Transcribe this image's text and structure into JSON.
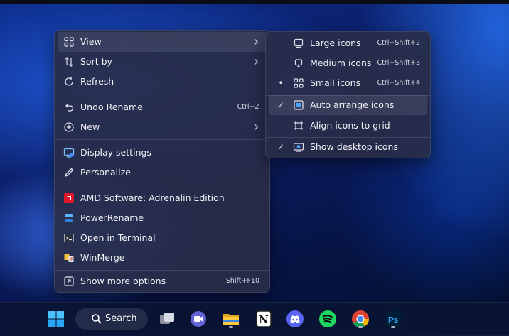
{
  "context_menu": {
    "items": [
      {
        "label": "View",
        "icon": "grid-view-icon",
        "submenu": true
      },
      {
        "label": "Sort by",
        "icon": "sort-icon",
        "submenu": true
      },
      {
        "label": "Refresh",
        "icon": "refresh-icon"
      },
      {
        "label": "Undo Rename",
        "icon": "undo-icon",
        "shortcut": "Ctrl+Z"
      },
      {
        "label": "New",
        "icon": "add-circle-icon",
        "submenu": true
      },
      {
        "label": "Display settings",
        "icon": "display-icon"
      },
      {
        "label": "Personalize",
        "icon": "pen-icon"
      },
      {
        "label": "AMD Software: Adrenalin Edition",
        "icon": "amd-icon"
      },
      {
        "label": "PowerRename",
        "icon": "powerrename-icon"
      },
      {
        "label": "Open in Terminal",
        "icon": "terminal-icon"
      },
      {
        "label": "WinMerge",
        "icon": "winmerge-icon"
      },
      {
        "label": "Show more options",
        "icon": "more-options-icon",
        "shortcut": "Shift+F10"
      }
    ]
  },
  "view_submenu": {
    "items": [
      {
        "label": "Large icons",
        "icon": "monitor-large-icon",
        "shortcut": "Ctrl+Shift+2",
        "state": ""
      },
      {
        "label": "Medium icons",
        "icon": "monitor-medium-icon",
        "shortcut": "Ctrl+Shift+3",
        "state": ""
      },
      {
        "label": "Small icons",
        "icon": "small-grid-icon",
        "shortcut": "Ctrl+Shift+4",
        "state": "selected"
      },
      {
        "label": "Auto arrange icons",
        "icon": "auto-arrange-icon",
        "state": "checked"
      },
      {
        "label": "Align icons to grid",
        "icon": "align-grid-icon",
        "state": ""
      },
      {
        "label": "Show desktop icons",
        "icon": "show-desktop-icon",
        "state": "checked"
      }
    ],
    "selected_mark": "•",
    "check_mark": "✓"
  },
  "taskbar": {
    "search_label": "Search",
    "apps": [
      "start-icon",
      "task-view-icon",
      "teams-icon",
      "file-explorer-icon",
      "notion-icon",
      "discord-icon",
      "spotify-icon",
      "chrome-icon",
      "photoshop-icon"
    ],
    "notion_glyph": "N",
    "photoshop_glyph": "Ps"
  },
  "colors": {
    "menu_bg": "#282c48",
    "accent_blue": "#4aa3ff",
    "spotify": "#1ed760",
    "discord": "#5865f2",
    "photoshop": "#31a8ff",
    "amd": "#e0162b"
  }
}
